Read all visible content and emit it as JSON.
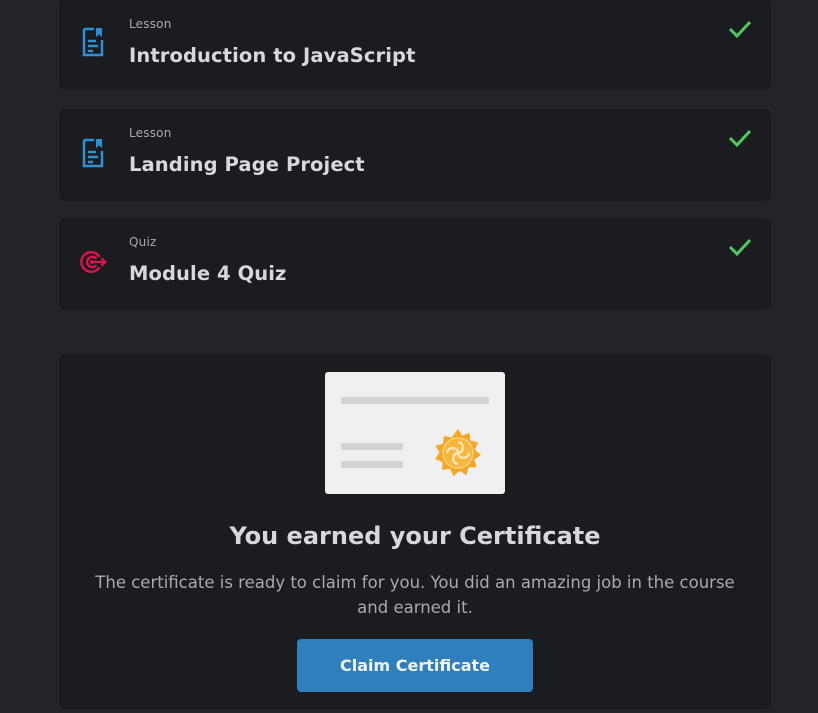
{
  "items": [
    {
      "type": "Lesson",
      "title": "Introduction to JavaScript",
      "icon": "lesson-document-icon",
      "completed": true
    },
    {
      "type": "Lesson",
      "title": "Landing Page Project",
      "icon": "lesson-document-icon",
      "completed": true
    },
    {
      "type": "Quiz",
      "title": "Module 4 Quiz",
      "icon": "quiz-target-icon",
      "completed": true
    }
  ],
  "certificate": {
    "title": "You earned your Certificate",
    "description": "The certificate is ready to claim for you. You did an amazing job in the course and earned it.",
    "button_label": "Claim Certificate"
  },
  "colors": {
    "page_background": "#232427",
    "card_background": "#1b1c1f",
    "lesson_icon": "#2d8fd5",
    "quiz_icon": "#e0124e",
    "check": "#4ccb5c",
    "button": "#2f7fbd",
    "seal": "#f5a623"
  }
}
